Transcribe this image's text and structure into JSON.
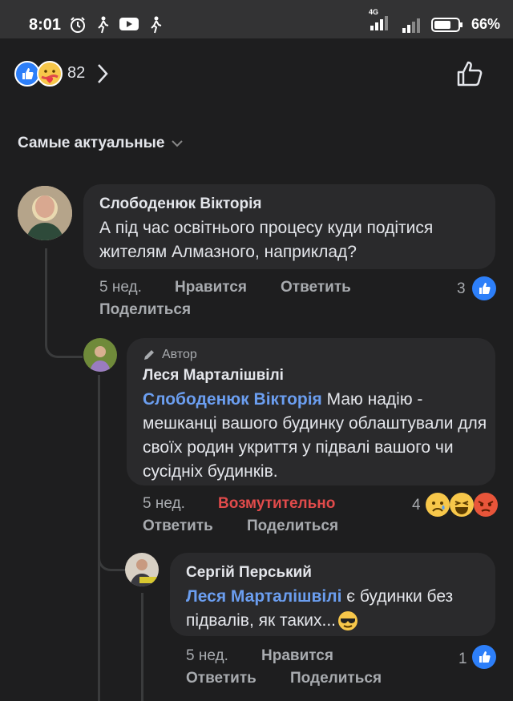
{
  "status": {
    "time": "8:01",
    "network": "4G",
    "battery": "66%"
  },
  "reactions": {
    "count": "82"
  },
  "sort_label": "Самые актуальные",
  "comments": [
    {
      "author": "Слободенюк Вікторія",
      "text": "А під час освітнього процесу куди подітися жителям Алмазного, наприклад?",
      "time": "5 нед.",
      "like": "Нравится",
      "reply": "Ответить",
      "share": "Поделиться",
      "count": "3"
    },
    {
      "badge": "Автор",
      "author": "Леся Марталішвілі",
      "mention": "Слободенюк Вікторія",
      "text": " Маю надію - мешканці вашого будинку облаштували для своїх родин укриття у підвалі вашого чи сусідніх будинків.",
      "time": "5 нед.",
      "reaction": "Возмутительно",
      "reply": "Ответить",
      "share": "Поделиться",
      "count": "4"
    },
    {
      "author": "Сергій Перський",
      "mention": "Леся Марталішвілі",
      "text": " є будинки без підвалів, як таких...",
      "time": "5 нед.",
      "like": "Нравится",
      "reply": "Ответить",
      "share": "Поделиться",
      "count": "1"
    }
  ],
  "colors": {
    "background": "#1e1e1f",
    "bubble": "#2a2a2c",
    "accent": "#2d7ff9",
    "mention": "#6b9ef0",
    "angry": "#e14b4b"
  }
}
